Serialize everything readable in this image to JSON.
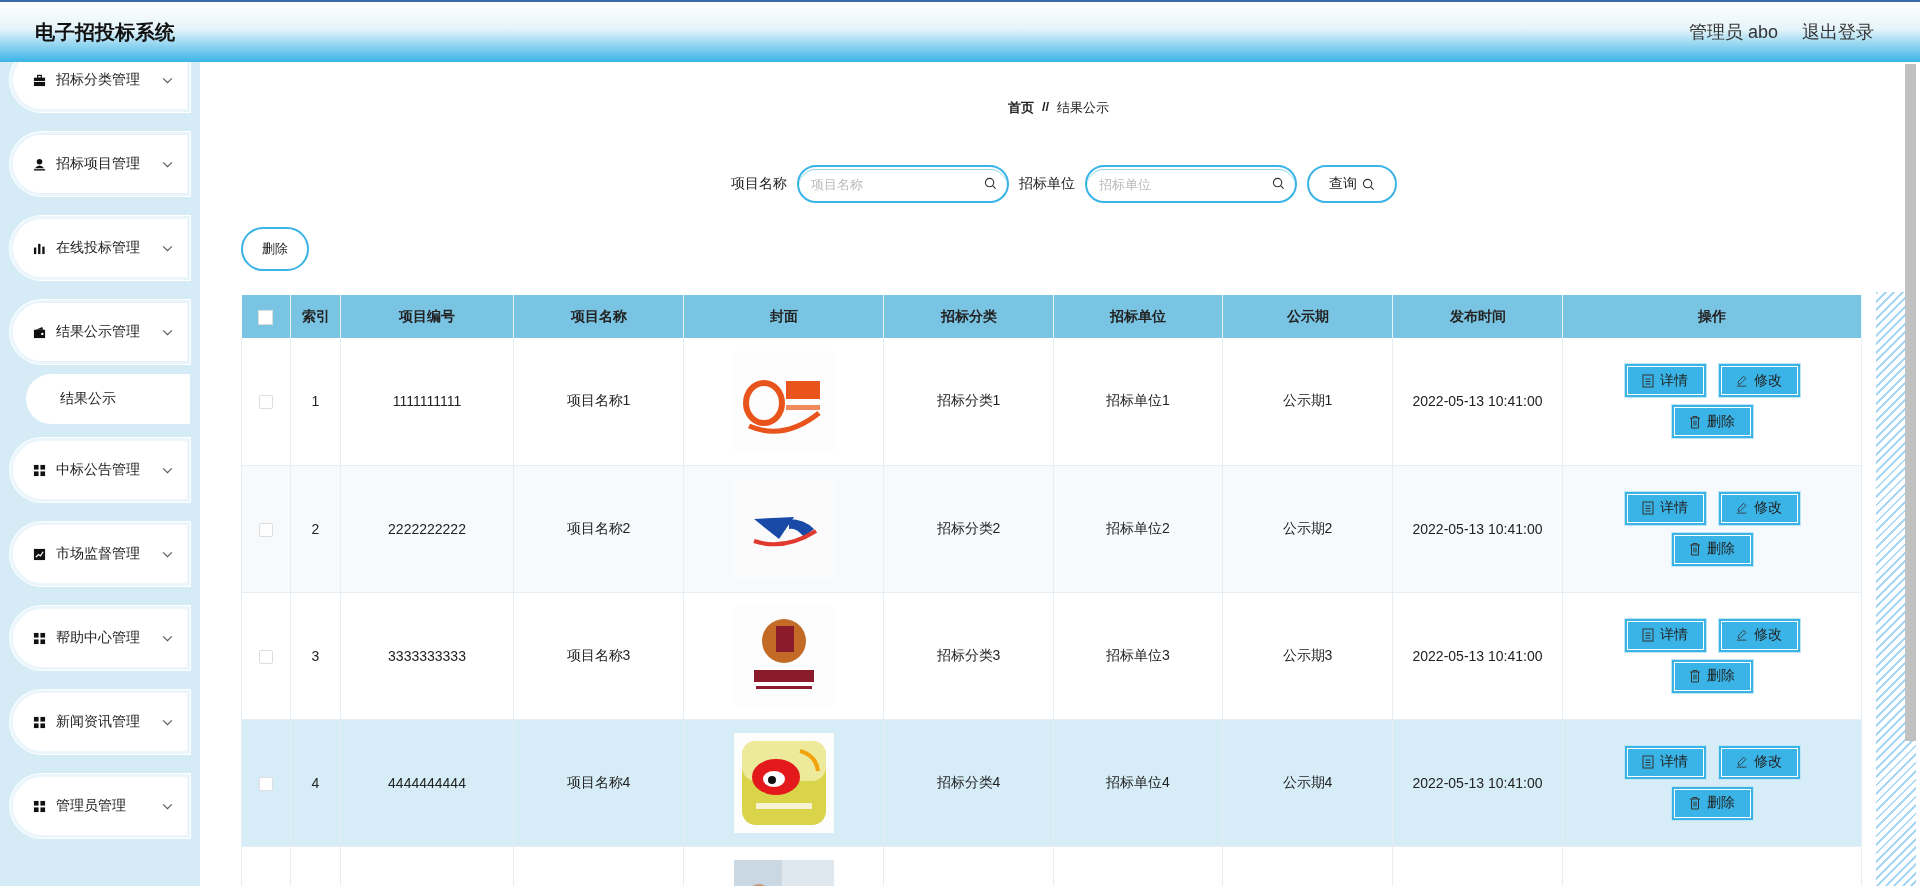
{
  "header": {
    "title": "电子招投标系统",
    "user": "管理员 abo",
    "logout": "退出登录"
  },
  "sidebar": {
    "items": [
      {
        "label": "招标分类管理"
      },
      {
        "label": "招标项目管理"
      },
      {
        "label": "在线投标管理"
      },
      {
        "label": "结果公示管理",
        "children": [
          {
            "label": "结果公示"
          }
        ]
      },
      {
        "label": "中标公告管理"
      },
      {
        "label": "市场监督管理"
      },
      {
        "label": "帮助中心管理"
      },
      {
        "label": "新闻资讯管理"
      },
      {
        "label": "管理员管理"
      }
    ]
  },
  "breadcrumb": {
    "home": "首页",
    "separator": "//",
    "current": "结果公示"
  },
  "search": {
    "fields": [
      {
        "label": "项目名称",
        "placeholder": "项目名称"
      },
      {
        "label": "招标单位",
        "placeholder": "招标单位"
      }
    ],
    "button": "查询"
  },
  "toolbar": {
    "delete": "删除"
  },
  "table": {
    "select_all": {
      "checked": false
    },
    "columns": [
      "索引",
      "项目编号",
      "项目名称",
      "封面",
      "招标分类",
      "招标单位",
      "公示期",
      "发布时间",
      "操作"
    ],
    "rows": [
      {
        "checked": false,
        "highlighted": false,
        "index": "1",
        "code": "1111111111",
        "name": "项目名称1",
        "category": "招标分类1",
        "unit": "招标单位1",
        "period": "公示期1",
        "time": "2022-05-13 10:41:00",
        "actions": [
          {
            "kind": "details",
            "label": "详情"
          },
          {
            "kind": "edit",
            "label": "修改"
          },
          {
            "kind": "delete",
            "label": "删除"
          }
        ]
      },
      {
        "checked": false,
        "highlighted": false,
        "index": "2",
        "code": "2222222222",
        "name": "项目名称2",
        "category": "招标分类2",
        "unit": "招标单位2",
        "period": "公示期2",
        "time": "2022-05-13 10:41:00",
        "actions": [
          {
            "kind": "details",
            "label": "详情"
          },
          {
            "kind": "edit",
            "label": "修改"
          },
          {
            "kind": "delete",
            "label": "删除"
          }
        ]
      },
      {
        "checked": false,
        "highlighted": false,
        "index": "3",
        "code": "3333333333",
        "name": "项目名称3",
        "category": "招标分类3",
        "unit": "招标单位3",
        "period": "公示期3",
        "time": "2022-05-13 10:41:00",
        "actions": [
          {
            "kind": "details",
            "label": "详情"
          },
          {
            "kind": "edit",
            "label": "修改"
          },
          {
            "kind": "delete",
            "label": "删除"
          }
        ]
      },
      {
        "checked": false,
        "highlighted": true,
        "index": "4",
        "code": "4444444444",
        "name": "项目名称4",
        "category": "招标分类4",
        "unit": "招标单位4",
        "period": "公示期4",
        "time": "2022-05-13 10:41:00",
        "actions": [
          {
            "kind": "details",
            "label": "详情"
          },
          {
            "kind": "edit",
            "label": "修改"
          },
          {
            "kind": "delete",
            "label": "删除"
          }
        ]
      },
      {
        "highlighted": false
      }
    ]
  }
}
